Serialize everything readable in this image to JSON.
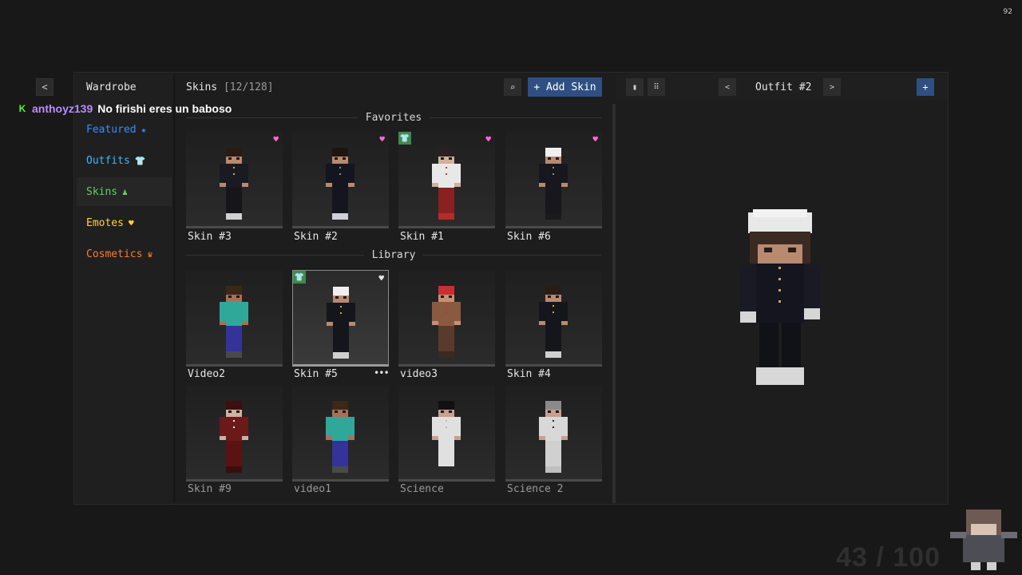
{
  "overlay": {
    "fps": "92",
    "chat_user": "anthoyz139",
    "chat_message": "No firishi eres un baboso",
    "chat_badge": "K",
    "counter": "43 / 100"
  },
  "nav": {
    "back": "<"
  },
  "sidebar": {
    "title": "Wardrobe",
    "items": [
      {
        "label": "Featured",
        "icon": "★",
        "icon_name": "star-icon",
        "color": "#3b8cff"
      },
      {
        "label": "Outfits",
        "icon": "👕",
        "icon_name": "tshirt-icon",
        "color": "#3fb6ff"
      },
      {
        "label": "Skins",
        "icon": "♟",
        "icon_name": "person-icon",
        "color": "#5fd35f"
      },
      {
        "label": "Emotes",
        "icon": "♥",
        "icon_name": "heart-icon",
        "color": "#ffd23f"
      },
      {
        "label": "Cosmetics",
        "icon": "♛",
        "icon_name": "crown-icon",
        "color": "#ff7a2f"
      }
    ],
    "active_index": 2
  },
  "skins_panel": {
    "title": "Skins",
    "count": "[12/128]",
    "search_icon": "⌕",
    "add_label": "+ Add Skin",
    "favorites_label": "Favorites",
    "library_label": "Library",
    "favorites": [
      {
        "label": "Skin #3",
        "heart": true,
        "equipped": false
      },
      {
        "label": "Skin #2",
        "heart": true,
        "equipped": false
      },
      {
        "label": "Skin #1",
        "heart": true,
        "equipped": true
      },
      {
        "label": "Skin #6",
        "heart": true,
        "equipped": false
      }
    ],
    "library": [
      {
        "label": "Video2"
      },
      {
        "label": "Skin #5",
        "selected": true,
        "equipped": true,
        "heart_outline": true,
        "menu": "•••"
      },
      {
        "label": "video3"
      },
      {
        "label": "Skin #4"
      },
      {
        "label": "Skin #9"
      },
      {
        "label": "video1"
      },
      {
        "label": "Science"
      },
      {
        "label": "Science 2"
      }
    ]
  },
  "outfit_panel": {
    "title": "Outfit #2",
    "prev": "<",
    "next": ">",
    "add": "+"
  },
  "colors": {
    "accent": "#2f4f82",
    "favorite_heart": "#ff6ad5",
    "equipped": "#3e8a4f"
  }
}
